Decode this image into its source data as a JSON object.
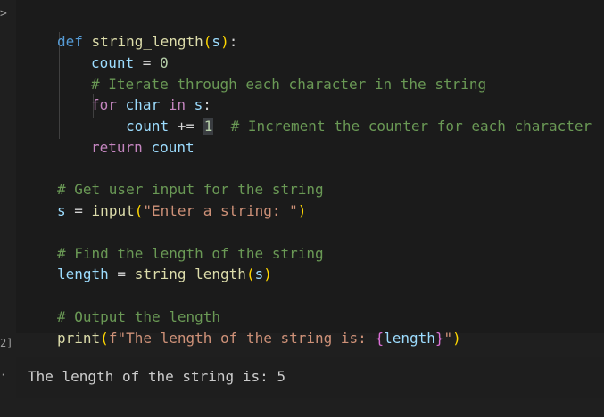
{
  "cell": {
    "gutter_marker": ">",
    "execution_count": "2]",
    "code": {
      "l1_def": "def",
      "l1_fn": "string_length",
      "l1_open": "(",
      "l1_param": "s",
      "l1_close": ")",
      "l1_colon": ":",
      "l2_var": "count",
      "l2_eq": " = ",
      "l2_num": "0",
      "l3_comment": "# Iterate through each character in the string",
      "l4_for": "for",
      "l4_char": "char",
      "l4_in": "in",
      "l4_s": "s",
      "l4_colon": ":",
      "l5_var": "count",
      "l5_op": " += ",
      "l5_num": "1",
      "l5_comment": "# Increment the counter for each character",
      "l6_return": "return",
      "l6_var": "count",
      "l8_comment": "# Get user input for the string",
      "l9_var": "s",
      "l9_eq": " = ",
      "l9_fn": "input",
      "l9_open": "(",
      "l9_str": "\"Enter a string: \"",
      "l9_close": ")",
      "l11_comment": "# Find the length of the string",
      "l12_var": "length",
      "l12_eq": " = ",
      "l12_fn": "string_length",
      "l12_open": "(",
      "l12_arg": "s",
      "l12_close": ")",
      "l14_comment": "# Output the length",
      "l15_fn": "print",
      "l15_open": "(",
      "l15_str1": "f\"The length of the string is: ",
      "l15_brace_open": "{",
      "l15_var": "length",
      "l15_brace_close": "}",
      "l15_str2": "\"",
      "l15_close": ")"
    },
    "output_marker": "·",
    "output": "The length of the string is: 5"
  },
  "colors": {
    "background": "#1f1f1f",
    "keyword": "#569cd6",
    "control": "#c586c0",
    "function": "#dcdcaa",
    "variable": "#9cdcfe",
    "number": "#b5cea8",
    "string": "#ce9178",
    "comment": "#6a9955",
    "bracket": "#ffd700"
  }
}
